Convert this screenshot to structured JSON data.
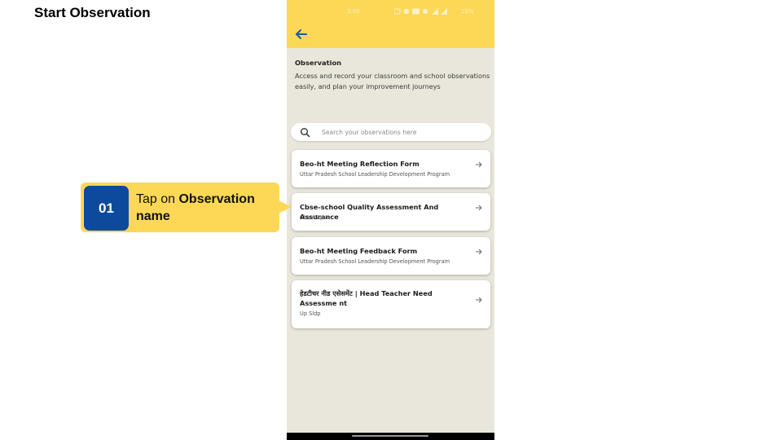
{
  "slide": {
    "title": "Start Observation"
  },
  "callout": {
    "step": "01",
    "text_prefix": "Tap on ",
    "text_bold": "Observation name"
  },
  "status_bar": {
    "time": "3:09",
    "battery": "22%"
  },
  "page": {
    "heading": "Observation",
    "description": "Access and record your classroom and school observations easily, and plan your improvement journeys"
  },
  "search": {
    "placeholder": "Search your observations here",
    "value": ""
  },
  "observations": [
    {
      "title": "Beo-ht Meeting Reflection Form",
      "subtitle": "Uttar Pradesh School Leadership Development Program"
    },
    {
      "title": "Cbse-school Quality Assessment And Assurance",
      "subtitle": "Cbse Sqaa"
    },
    {
      "title": "Beo-ht Meeting Feedback Form",
      "subtitle": "Uttar Pradesh School Leadership Development Program"
    },
    {
      "title": "हेडटीचर नीड एसेसमेंट | Head Teacher Need Assessme nt",
      "subtitle": "Up Sldp"
    }
  ],
  "icons": {
    "back": "arrow-left-icon",
    "search": "search-icon",
    "card_arrow": "arrow-right-icon"
  },
  "colors": {
    "accent_yellow": "#fdd857",
    "badge_blue": "#0d4a9c",
    "app_background": "#e9e7db"
  }
}
